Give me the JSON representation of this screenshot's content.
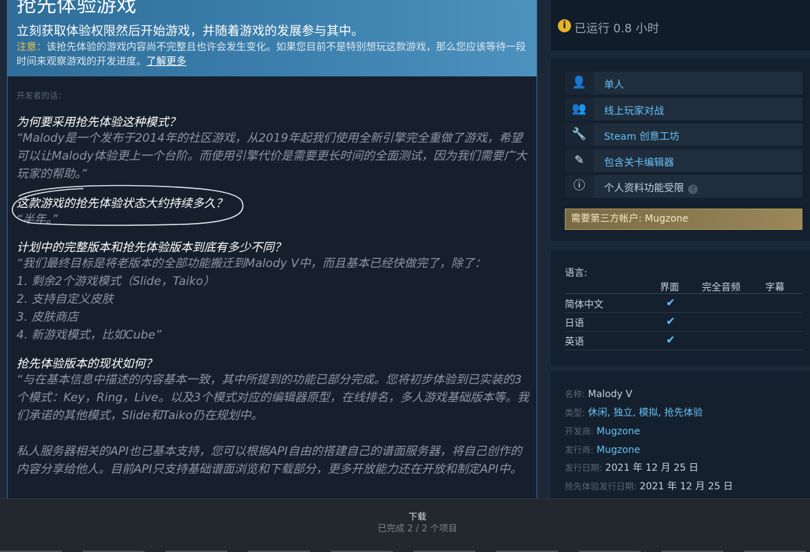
{
  "early_access": {
    "title": "抢先体验游戏",
    "tagline": "立刻获取体验权限然后开始游戏，并随着游戏的发展参与其中。",
    "notice_label": "注意：",
    "notice_text": "该抢先体验的游戏内容尚不完整且也许会发生变化。如果您目前不是特别想玩这款游戏，那么您应该等待一段时间来观察游戏的开发进度。",
    "learn_more": "了解更多"
  },
  "developer_notes": {
    "caption": "开发者的话：",
    "faq": [
      {
        "question": "为何要采用抢先体验这种模式？",
        "answer": "“Malody是一个发布于2014年的社区游戏，从2019年起我们使用全新引擎完全重做了游戏，希望可以让Malody体验更上一个台阶。而使用引擎代价是需要更长时间的全面测试，因为我们需要广大玩家的帮助。”"
      },
      {
        "question": "这款游戏的抢先体验状态大约持续多久？",
        "answer": "“半年。”"
      },
      {
        "question": "计划中的完整版本和抢先体验版本到底有多少不同？",
        "answer_lines": [
          "“我们最终目标是将老版本的全部功能搬迁到Malody V中，而且基本已经快做完了，除了：",
          "1. 剩余2个游戏模式（Slide，Taiko）",
          "2. 支持自定义皮肤",
          "3. 皮肤商店",
          "4. 新游戏模式，比如Cube”"
        ]
      },
      {
        "question": "抢先体验版本的现状如何？",
        "answer": "“与在基本信息中描述的内容基本一致，其中所提到的功能已部分完成。您将初步体验到已实装的3个模式：Key，Ring，Live。以及3个模式对应的编辑器原型，在线排名，多人游戏基础版本等。我们承诺的其他模式，Slide和Taiko仍在规划中。",
        "answer_extra": "私人服务器相关的API也已基本支持，您可以根据API自由的搭建自己的谱面服务器，将自己创作的内容分享给他人。目前API只支持基础谱面浏览和下载部分，更多开放能力还在开放和制定API中。"
      }
    ]
  },
  "playtime": {
    "icon": "info-icon",
    "text": "已运行 0.8 小时"
  },
  "features": [
    {
      "icon": "single-player-icon",
      "glyph": "👤",
      "label": "单人",
      "link": true
    },
    {
      "icon": "online-pvp-icon",
      "glyph": "👥",
      "label": "线上玩家对战",
      "link": true
    },
    {
      "icon": "workshop-icon",
      "glyph": "🔧",
      "label": "Steam 创意工坊",
      "link": true
    },
    {
      "icon": "level-editor-icon",
      "glyph": "✎",
      "label": "包含关卡编辑器",
      "link": true
    },
    {
      "icon": "info-circle-icon",
      "glyph": "ⓘ",
      "label": "个人资料功能受限",
      "link": false,
      "help": "?"
    }
  ],
  "third_party_account": "需要第三方帐户: Mugzone",
  "languages": {
    "title": "语言:",
    "headers": [
      "界面",
      "完全音频",
      "字幕"
    ],
    "check_glyph": "✔",
    "rows": [
      {
        "name": "简体中文",
        "interface": true,
        "audio": false,
        "subtitles": false
      },
      {
        "name": "日语",
        "interface": true,
        "audio": false,
        "subtitles": false
      },
      {
        "name": "英语",
        "interface": true,
        "audio": false,
        "subtitles": false
      }
    ]
  },
  "details": {
    "name_key": "名称:",
    "name_val": "Malody V",
    "genre_key": "类型:",
    "genres": [
      "休闲",
      "独立",
      "模拟",
      "抢先体验"
    ],
    "developer_key": "开发商:",
    "developer": "Mugzone",
    "publisher_key": "发行商:",
    "publisher": "Mugzone",
    "release_key": "发行日期:",
    "release": "2021 年 12 月 25 日",
    "ea_release_key": "抢先体验发行日期:",
    "ea_release": "2021 年 12 月 25 日"
  },
  "download_bar": {
    "title": "下载",
    "status": "已完成 2 / 2 个项目"
  },
  "colors": {
    "background": "#1b2838",
    "link": "#67c1f5",
    "notice_label": "#f0c14a",
    "banner": "#3c80ad"
  }
}
